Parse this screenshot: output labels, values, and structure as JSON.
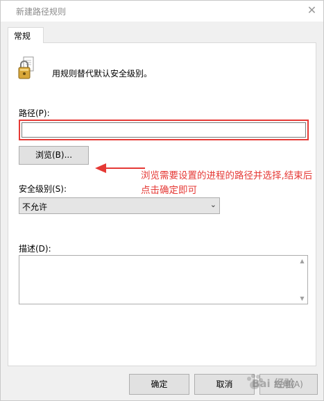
{
  "window": {
    "title": "新建路径规则",
    "close_glyph": "✕"
  },
  "tabs": [
    {
      "label": "常规",
      "active": true
    }
  ],
  "general": {
    "description_text": "用规则替代默认安全级别。",
    "path_label": "路径(P):",
    "path_value": "",
    "browse_button": "浏览(B)...",
    "security_level_label": "安全级别(S):",
    "security_level_value": "不允许",
    "description_label": "描述(D):",
    "description_value": ""
  },
  "annotation": {
    "text": "浏览需要设置的进程的路径并选择,结束后点击确定即可",
    "color": "#e53935"
  },
  "footer": {
    "ok": "确定",
    "cancel": "取消",
    "apply": "应用(A)"
  },
  "watermark": {
    "text": "Bai 经验"
  },
  "icons": {
    "lock": "lock-icon",
    "close": "close-icon",
    "dropdown": "chevron-down-icon"
  }
}
